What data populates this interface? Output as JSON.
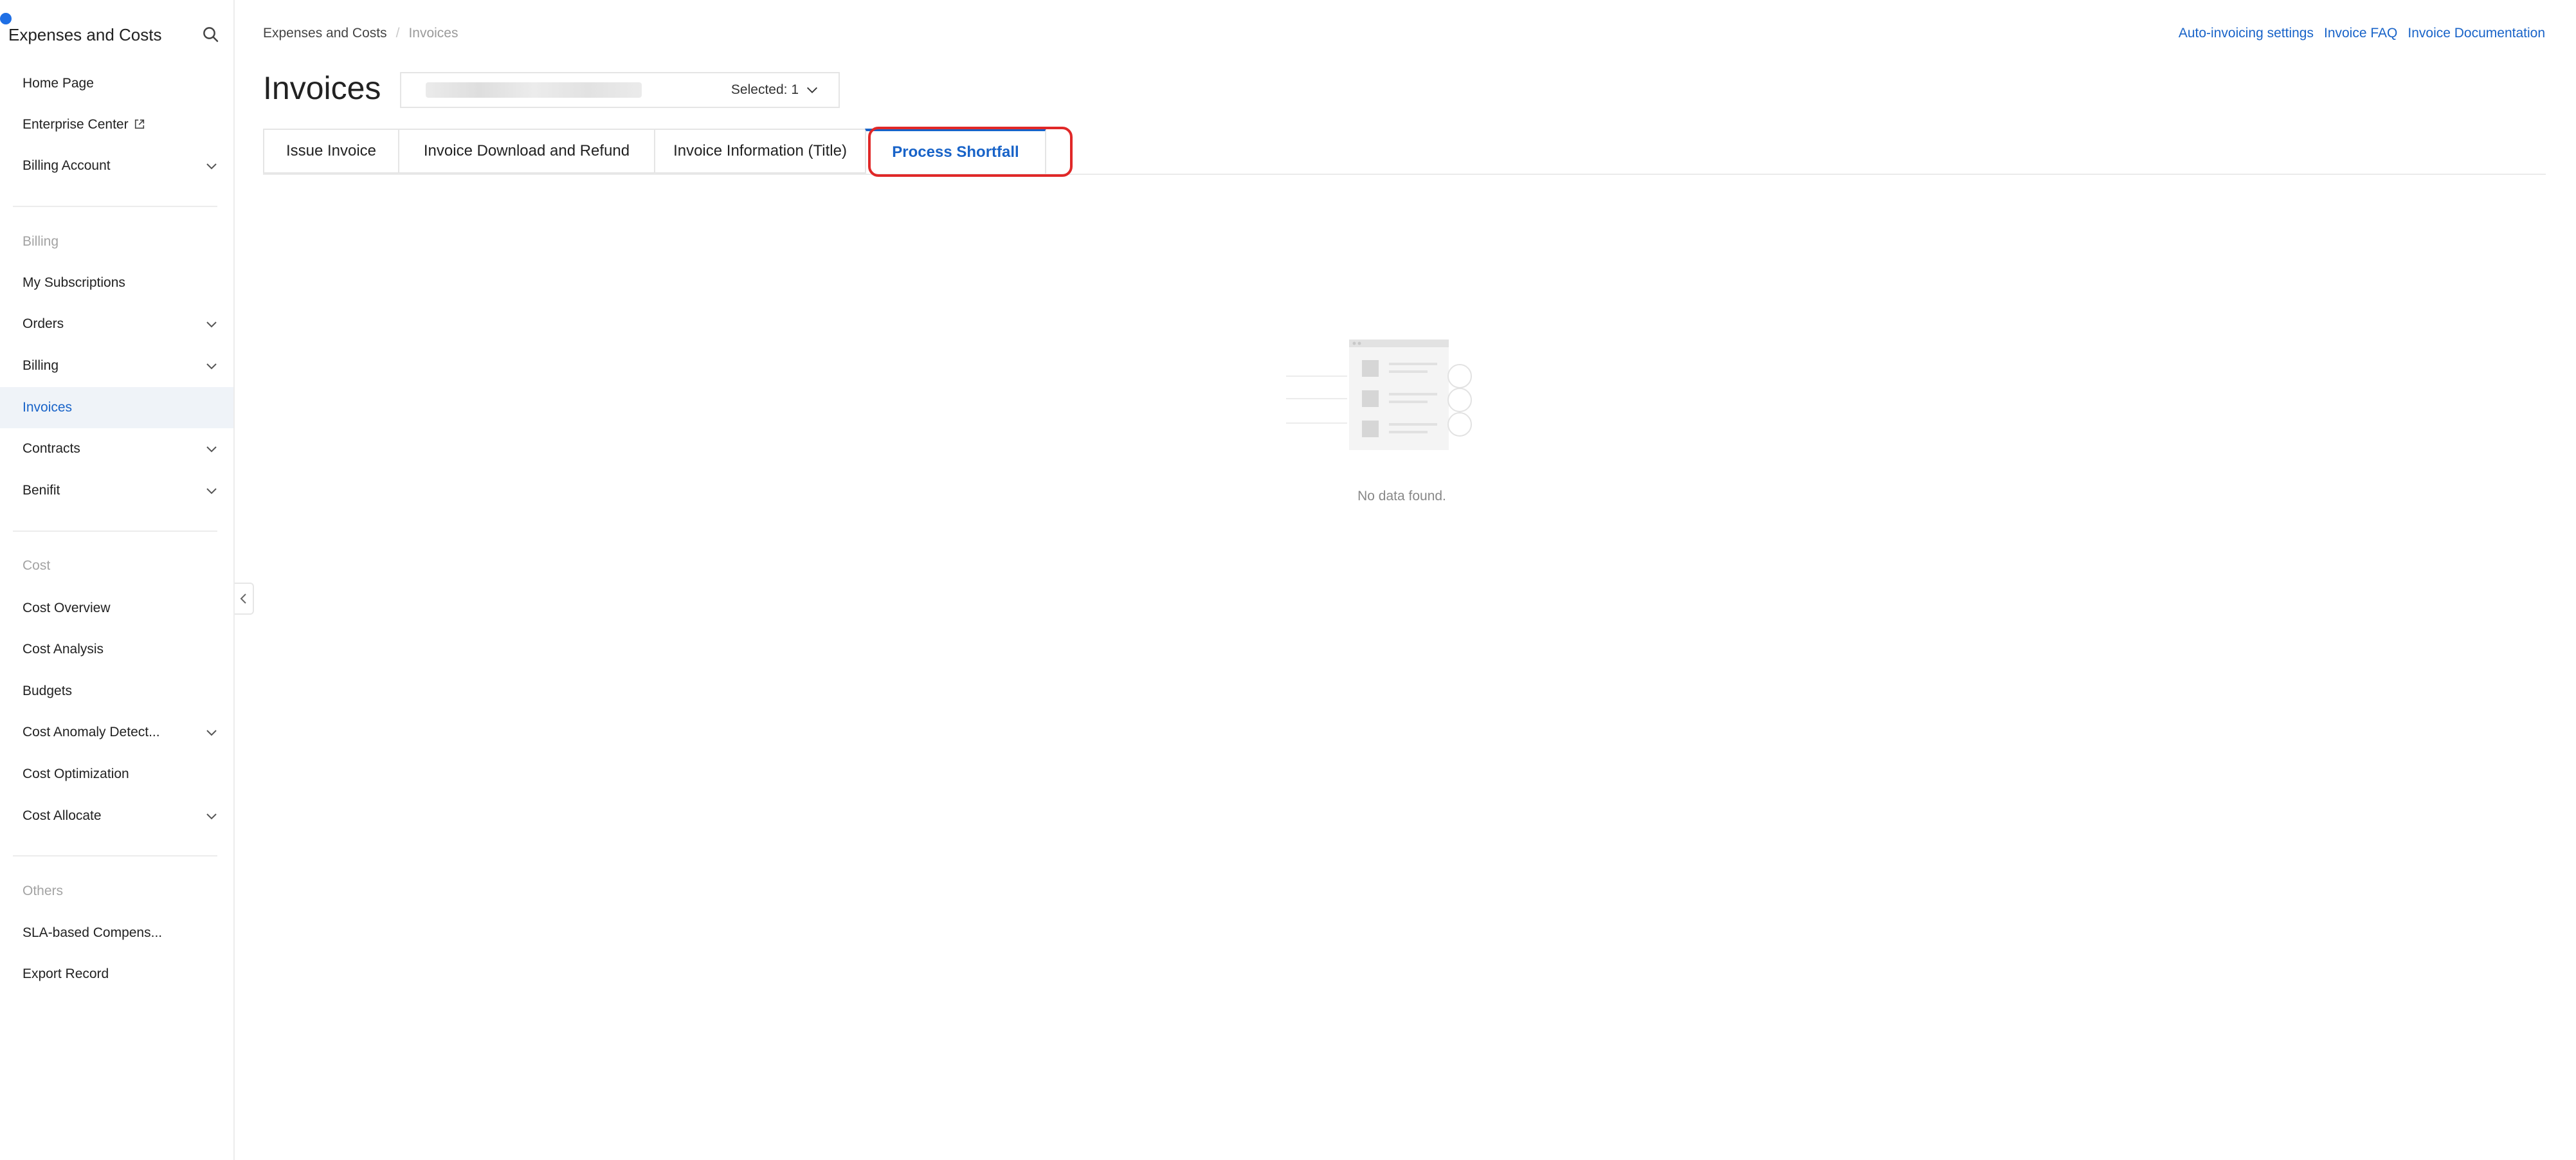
{
  "sidebar": {
    "title": "Expenses and Costs",
    "items": {
      "home": "Home Page",
      "enterprise": "Enterprise Center",
      "billing_account": "Billing Account",
      "billing_section": "Billing",
      "subscriptions": "My Subscriptions",
      "orders": "Orders",
      "billing": "Billing",
      "invoices": "Invoices",
      "contracts": "Contracts",
      "benifit": "Benifit",
      "cost_section": "Cost",
      "cost_overview": "Cost Overview",
      "cost_analysis": "Cost Analysis",
      "budgets": "Budgets",
      "cost_anomaly": "Cost Anomaly Detect...",
      "cost_optimization": "Cost Optimization",
      "cost_allocate": "Cost Allocate",
      "others_section": "Others",
      "sla": "SLA-based Compens...",
      "export": "Export Record"
    }
  },
  "breadcrumb": {
    "first": "Expenses and Costs",
    "separator": "/",
    "second": "Invoices"
  },
  "top_links": {
    "auto_invoicing": "Auto-invoicing settings",
    "faq": "Invoice FAQ",
    "documentation": "Invoice Documentation"
  },
  "page": {
    "title": "Invoices"
  },
  "selector": {
    "selected": "Selected: 1"
  },
  "tabs": {
    "issue": "Issue Invoice",
    "download": "Invoice Download and Refund",
    "information": "Invoice Information (Title)",
    "shortfall": "Process Shortfall"
  },
  "empty": {
    "message": "No data found."
  },
  "colors": {
    "accent": "#1863c8",
    "highlight": "#e02828",
    "active_bg": "#eff3f8"
  }
}
